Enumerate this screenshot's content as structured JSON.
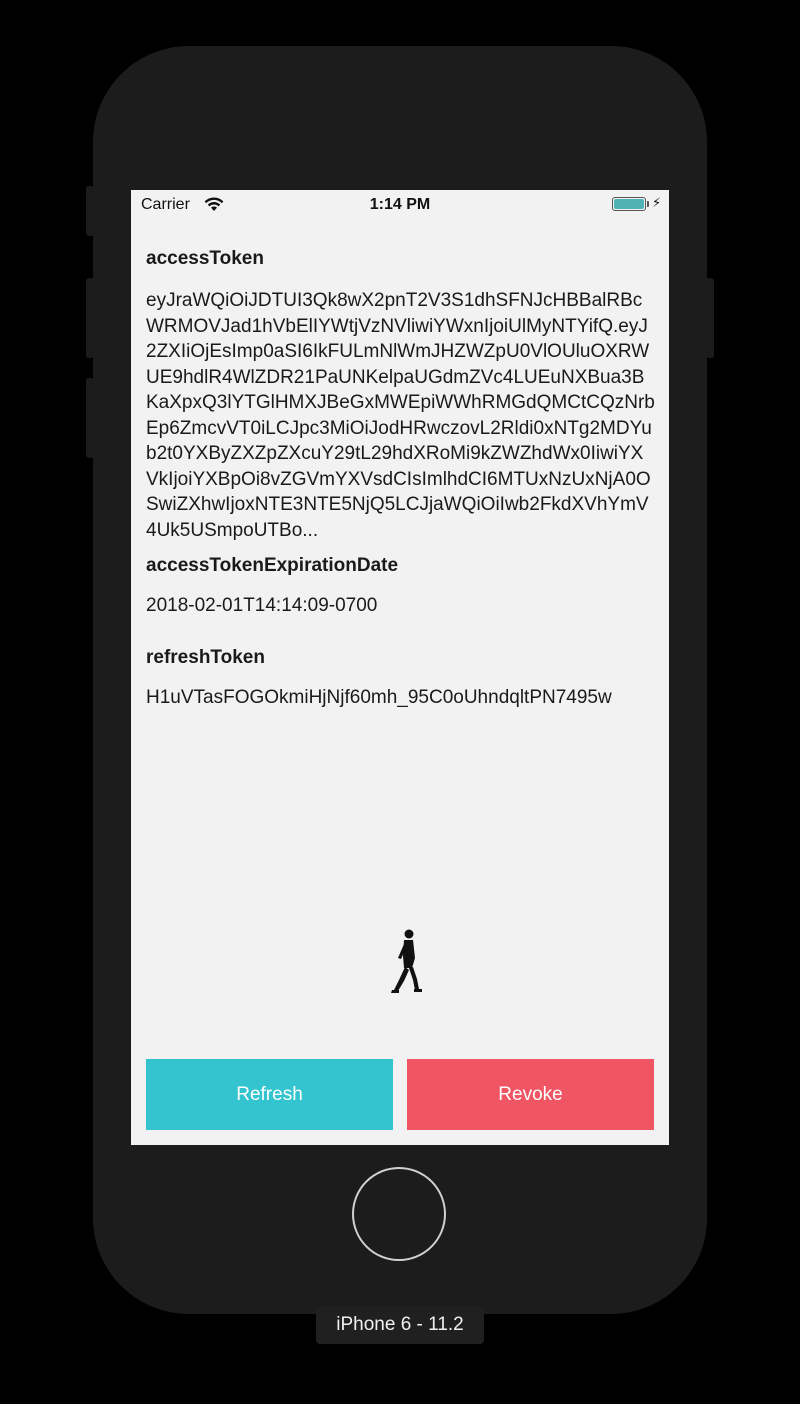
{
  "status_bar": {
    "carrier": "Carrier",
    "time": "1:14 PM",
    "battery_color": "#4fb3b3"
  },
  "fields": [
    {
      "label": "accessToken",
      "value": "eyJraWQiOiJDTUI3Qk8wX2pnT2V3S1dhSFNJcHBBalRBcWRMOVJad1hVbElIYWtjVzNVliwiYWxnIjoiUlMyNTYifQ.eyJ2ZXIiOjEsImp0aSI6IkFULmNlWmJHZWZpU0VlOUluOXRWUE9hdlR4WlZDR21PaUNKelpaUGdmZVc4LUEuNXBua3BKaXpxQ3lYTGlHMXJBeGxMWEpiWWhRMGdQMCtCQzNrbEp6ZmcvVT0iLCJpc3MiOiJodHRwczovL2Rldi0xNTg2MDYub2t0YXByZXZpZXcuY29tL29hdXRoMi9kZWZhdWx0IiwiYXVkIjoiYXBpOi8vZGVmYXVsdCIsImlhdCI6MTUxNzUxNjA0OSwiZXhwIjoxNTE3NTE5NjQ5LCJjaWQiOiIwb2FkdXVhYmV4Uk5USmpoUTBo..."
    },
    {
      "label": "accessTokenExpirationDate",
      "value": "2018-02-01T14:14:09-0700"
    },
    {
      "label": "refreshToken",
      "value": "H1uVTasFOGOkmiHjNjf60mh_95C0oUhndqltPN7495w"
    }
  ],
  "buttons": {
    "refresh": {
      "label": "Refresh",
      "color": "#33c4cf"
    },
    "revoke": {
      "label": "Revoke",
      "color": "#f05563"
    }
  },
  "device": {
    "label": "iPhone 6 - 11.2"
  }
}
